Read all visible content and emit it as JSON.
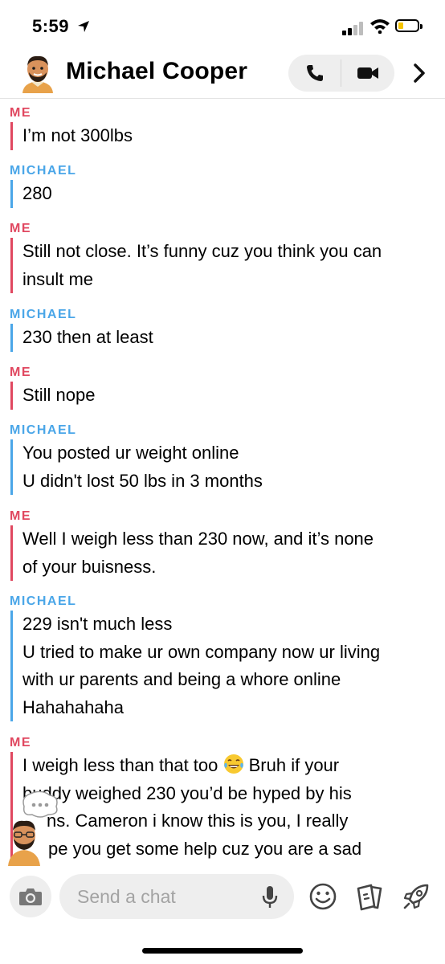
{
  "status_bar": {
    "time": "5:59"
  },
  "header": {
    "contact_name": "Michael Cooper"
  },
  "messages": [
    {
      "sender": "ME",
      "lines": [
        "I’m not 300lbs"
      ]
    },
    {
      "sender": "MICHAEL",
      "lines": [
        "280"
      ]
    },
    {
      "sender": "ME",
      "lines": [
        "Still not close. It’s funny cuz you think you can",
        "insult me"
      ]
    },
    {
      "sender": "MICHAEL",
      "lines": [
        "230 then at least"
      ]
    },
    {
      "sender": "ME",
      "lines": [
        "Still nope"
      ]
    },
    {
      "sender": "MICHAEL",
      "lines": [
        "You posted ur weight online",
        "U didn't lost 50 lbs in 3 months"
      ]
    },
    {
      "sender": "ME",
      "lines": [
        "Well I weigh less than 230 now, and it’s none",
        "of your buisness."
      ]
    },
    {
      "sender": "MICHAEL",
      "lines": [
        "229 isn't much less",
        "U tried to make ur own company now ur living",
        "with ur parents and being a whore online",
        "Hahahahaha"
      ]
    },
    {
      "sender": "ME",
      "lines": [
        "I weigh less than that too",
        "Bruh if your",
        "buddy weighed 230 you’d be hyped by his",
        "ns. Cameron i know this is you, I really",
        "pe you get some help cuz you are a sad"
      ]
    }
  ],
  "composer": {
    "placeholder": "Send a chat"
  },
  "icons": {
    "location": "location-arrow-icon",
    "phone": "phone-icon",
    "video": "video-camera-icon",
    "chevron": "chevron-right-icon",
    "camera": "camera-icon",
    "mic": "microphone-icon",
    "emoji": "smiley-icon",
    "stickers": "sticker-cards-icon",
    "games": "rocket-icon",
    "laugh": "laughing-tears-emoji"
  },
  "colors": {
    "me": "#e04860",
    "them": "#4aa6e8",
    "input_bg": "#eeeeee"
  }
}
